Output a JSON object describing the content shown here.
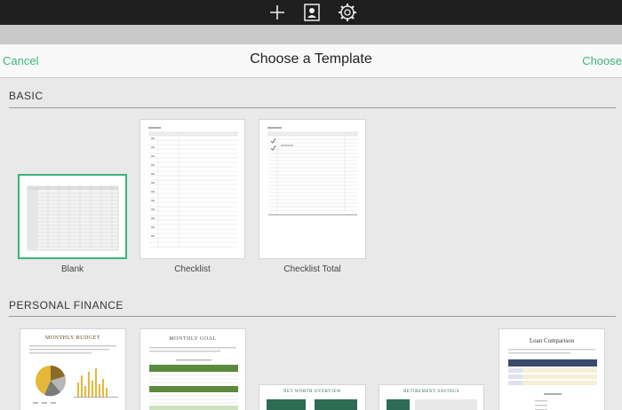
{
  "nav": {
    "cancel_label": "Cancel",
    "title": "Choose a Template",
    "choose_label": "Choose"
  },
  "icons": {
    "add": "plus-icon",
    "media": "portrait-icon",
    "settings": "gear-icon"
  },
  "colors": {
    "accent": "#3bb37b",
    "topbar": "#1f1f1f",
    "background": "#e9e9e9"
  },
  "sections": {
    "basic": {
      "title": "BASIC",
      "templates": [
        {
          "label": "Blank",
          "selected": true
        },
        {
          "label": "Checklist",
          "selected": false
        },
        {
          "label": "Checklist Total",
          "selected": false
        }
      ]
    },
    "finance": {
      "title": "PERSONAL FINANCE",
      "templates": [
        {
          "thumb_title": "MONTHLY BUDGET"
        },
        {
          "thumb_title": "MONTHLY GOAL"
        },
        {
          "thumb_title": "NET WORTH OVERVIEW"
        },
        {
          "thumb_title": "RETIREMENT SAVINGS"
        },
        {
          "thumb_title": "Loan Comparison"
        }
      ]
    }
  }
}
